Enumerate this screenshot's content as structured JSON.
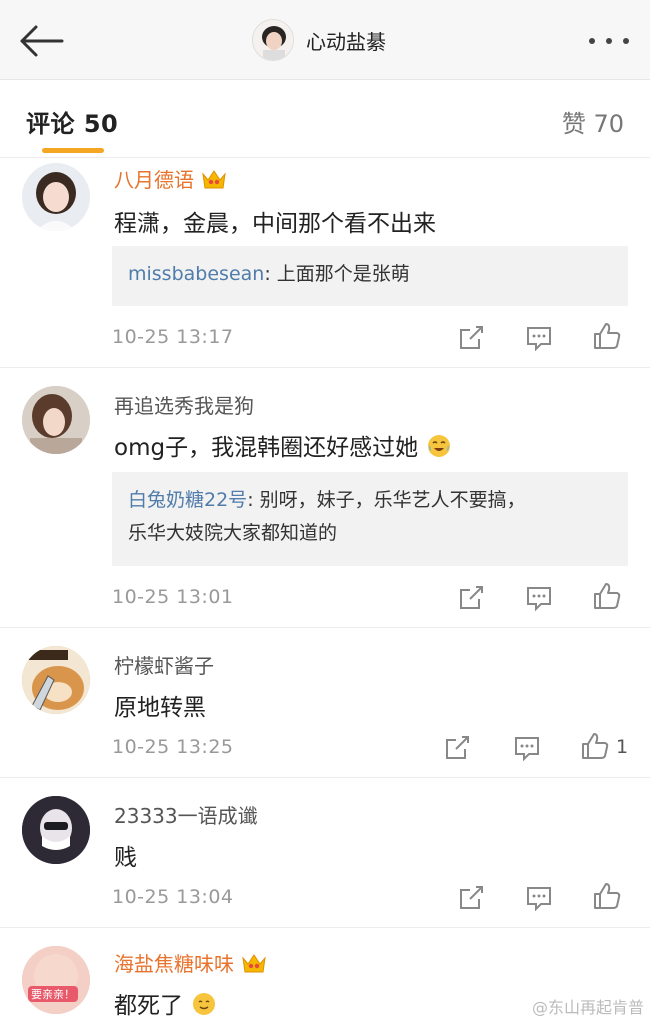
{
  "header": {
    "title": "心动盐綦",
    "back_icon": "arrow-left-icon",
    "more_icon": "ellipsis-icon"
  },
  "tabs": {
    "comments_label": "评论 50",
    "likes_label": "赞 70",
    "accent": "#f5a623"
  },
  "comments": [
    {
      "username": "八月德语",
      "vip": true,
      "text": "程潇，金晨，中间那个看不出来",
      "reply_user": "missbabesean",
      "reply_text": ": 上面那个是张萌",
      "time": "10-25 13:17",
      "likes": ""
    },
    {
      "username": "再追选秀我是狗",
      "vip": false,
      "text": "omg子，我混韩圈还好感过她",
      "reply_user": "白兔奶糖22号",
      "reply_text": ": 别呀，妹子，乐华艺人不要搞，",
      "reply_text_2": "乐华大妓院大家都知道的",
      "time": "10-25 13:01",
      "likes": ""
    },
    {
      "username": "柠檬虾酱子",
      "vip": false,
      "text": "原地转黑",
      "time": "10-25 13:25",
      "likes": "1"
    },
    {
      "username": "23333一语成谶",
      "vip": false,
      "text": "贱",
      "time": "10-25 13:04",
      "likes": ""
    },
    {
      "username": "海盐焦糖味味",
      "vip": true,
      "text": "都死了",
      "avatar_text": "要亲亲！",
      "time": "",
      "likes": ""
    }
  ],
  "watermark": "@东山再起肯普",
  "colors": {
    "vip_name": "#e8732c",
    "reply_user": "#4f7caa",
    "meta_gray": "#999999"
  }
}
